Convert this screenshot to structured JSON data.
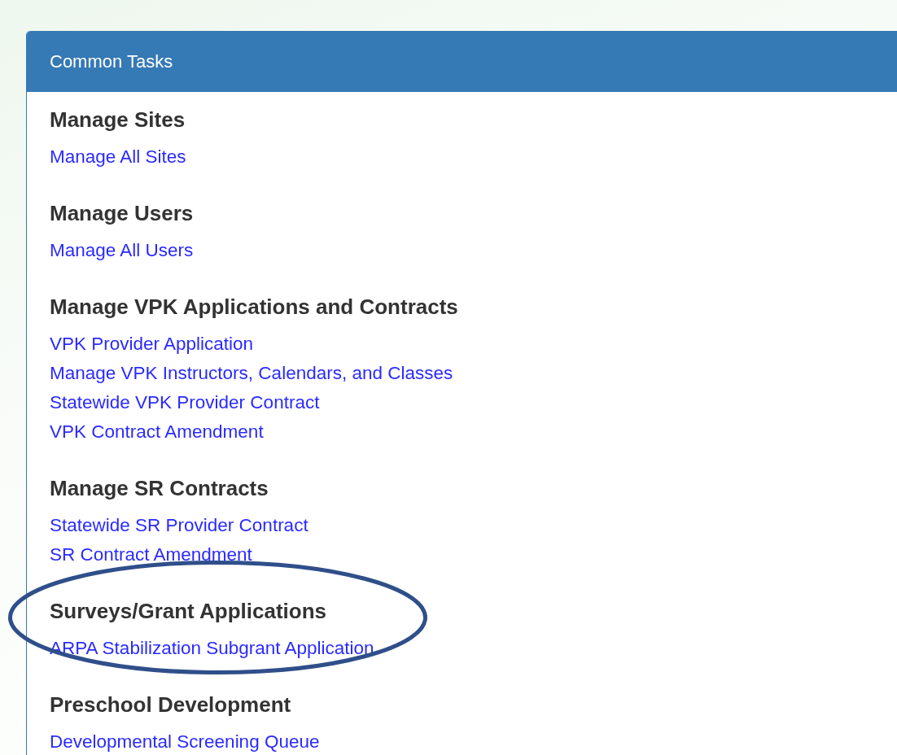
{
  "panel": {
    "title": "Common Tasks"
  },
  "sections": [
    {
      "heading": "Manage Sites",
      "links": [
        "Manage All Sites"
      ]
    },
    {
      "heading": "Manage Users",
      "links": [
        "Manage All Users"
      ]
    },
    {
      "heading": "Manage VPK Applications and Contracts",
      "links": [
        "VPK Provider Application",
        "Manage VPK Instructors, Calendars, and Classes",
        "Statewide VPK Provider Contract",
        "VPK Contract Amendment"
      ]
    },
    {
      "heading": "Manage SR Contracts",
      "links": [
        "Statewide SR Provider Contract",
        "SR Contract Amendment"
      ]
    },
    {
      "heading": "Surveys/Grant Applications",
      "highlighted": true,
      "links": [
        "ARPA Stabilization Subgrant Application"
      ]
    },
    {
      "heading": "Preschool Development",
      "links": [
        "Developmental Screening Queue"
      ]
    }
  ]
}
